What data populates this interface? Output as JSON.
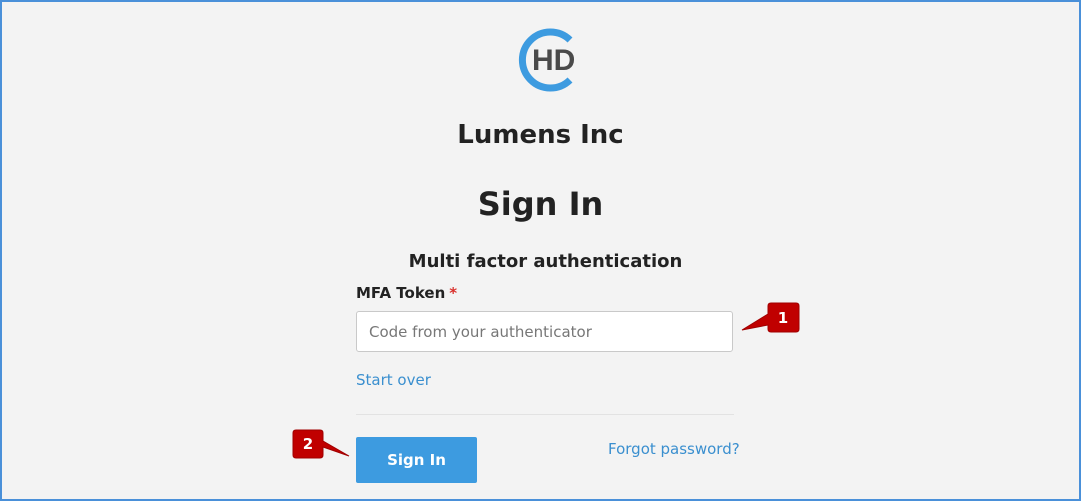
{
  "brand": {
    "logo_text": "HD",
    "company_name": "Lumens Inc",
    "logo_ring_color": "#3d9be0",
    "logo_text_color": "#4a4a4a"
  },
  "page": {
    "title": "Sign In",
    "subtitle": "Multi factor authentication"
  },
  "form": {
    "token_label": "MFA Token",
    "required_marker": "*",
    "token_value": "",
    "token_placeholder": "Code from your authenticator",
    "start_over_label": "Start over",
    "submit_label": "Sign In",
    "forgot_label": "Forgot password?"
  },
  "annotations": {
    "marker_1": "1",
    "marker_2": "2",
    "marker_color": "#c00000"
  },
  "colors": {
    "accent": "#3d9be0",
    "link": "#3a8fcf",
    "frame_border": "#4a90d9"
  }
}
